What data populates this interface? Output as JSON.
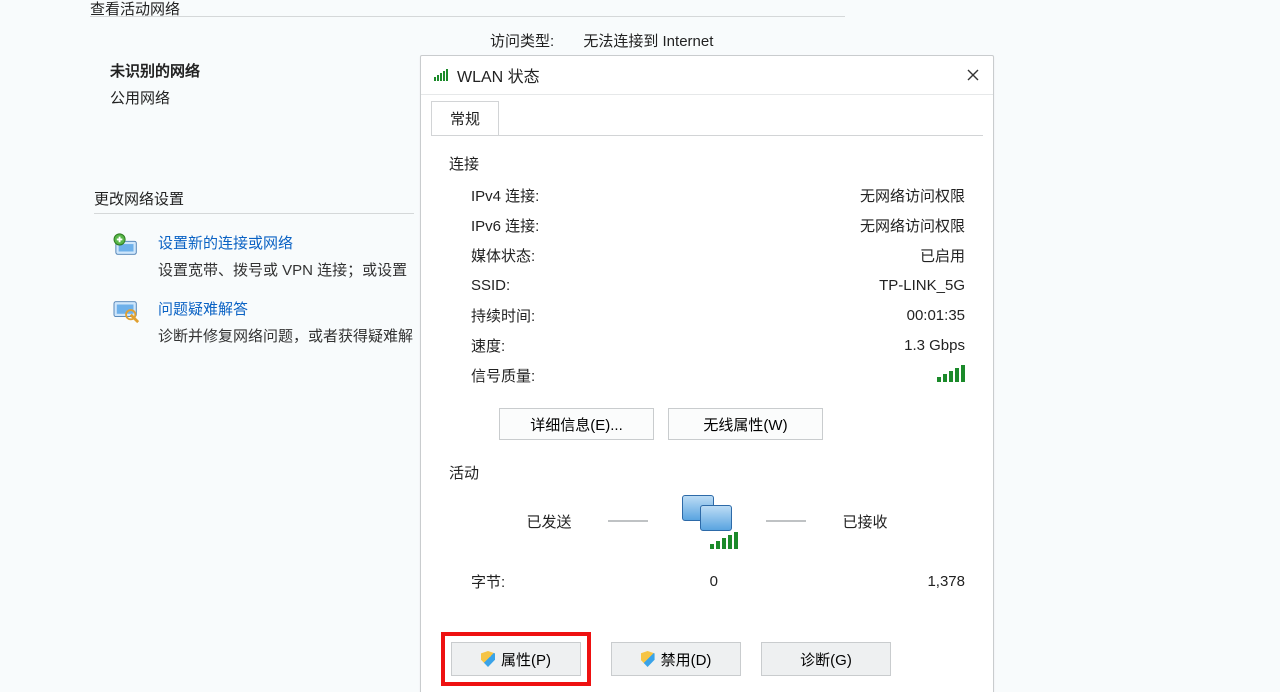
{
  "background": {
    "view_active_network": "查看活动网络",
    "access_type_label": "访问类型:",
    "access_type_value": "无法连接到 Internet",
    "unknown_network_title": "未识别的网络",
    "unknown_network_type": "公用网络",
    "change_settings_header": "更改网络设置",
    "task_setup_link": "设置新的连接或网络",
    "task_setup_desc": "设置宽带、拨号或 VPN 连接；或设置",
    "task_diag_link": "问题疑难解答",
    "task_diag_desc": "诊断并修复网络问题，或者获得疑难解"
  },
  "dialog": {
    "title": "WLAN 状态",
    "tab_general": "常规",
    "section_connection": "连接",
    "ipv4_label": "IPv4 连接:",
    "ipv4_value": "无网络访问权限",
    "ipv6_label": "IPv6 连接:",
    "ipv6_value": "无网络访问权限",
    "media_label": "媒体状态:",
    "media_value": "已启用",
    "ssid_label": "SSID:",
    "ssid_value": "TP-LINK_5G",
    "duration_label": "持续时间:",
    "duration_value": "00:01:35",
    "speed_label": "速度:",
    "speed_value": "1.3 Gbps",
    "signal_label": "信号质量:",
    "btn_details": "详细信息(E)...",
    "btn_wireless_props": "无线属性(W)",
    "section_activity": "活动",
    "sent_label": "已发送",
    "recv_label": "已接收",
    "bytes_label": "字节:",
    "bytes_sent": "0",
    "bytes_recv": "1,378",
    "btn_properties": "属性(P)",
    "btn_disable": "禁用(D)",
    "btn_diagnose": "诊断(G)"
  }
}
